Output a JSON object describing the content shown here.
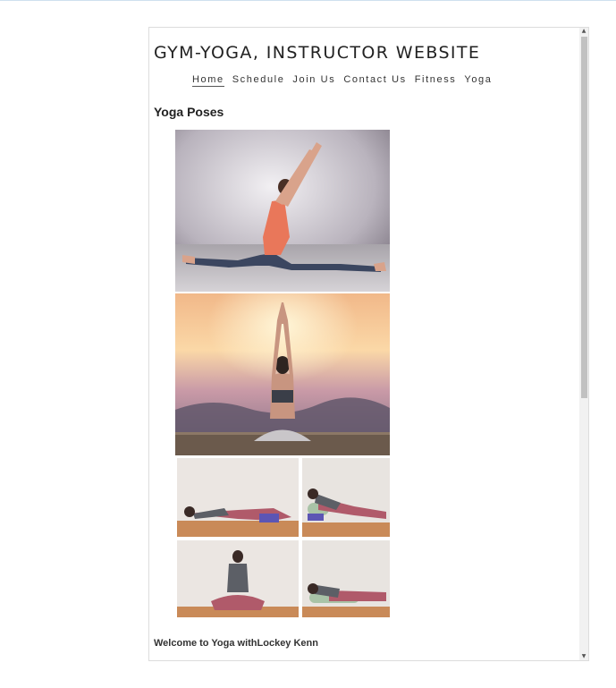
{
  "site": {
    "title": "GYM-YOGA, INSTRUCTOR WEBSITE"
  },
  "nav": {
    "items": [
      {
        "label": "Home",
        "active": true
      },
      {
        "label": "Schedule",
        "active": false
      },
      {
        "label": "Join Us",
        "active": false
      },
      {
        "label": "Contact Us",
        "active": false
      },
      {
        "label": "Fitness",
        "active": false
      },
      {
        "label": "Yoga",
        "active": false
      }
    ]
  },
  "main": {
    "heading": "Yoga Poses",
    "welcome": "Welcome to Yoga withLockey Kenn"
  },
  "icons": {
    "scroll_up": "triangle-up-icon",
    "scroll_down": "triangle-down-icon"
  },
  "colors": {
    "scroll_thumb": "#c1c1c1",
    "scroll_track": "#f1f1f1"
  }
}
